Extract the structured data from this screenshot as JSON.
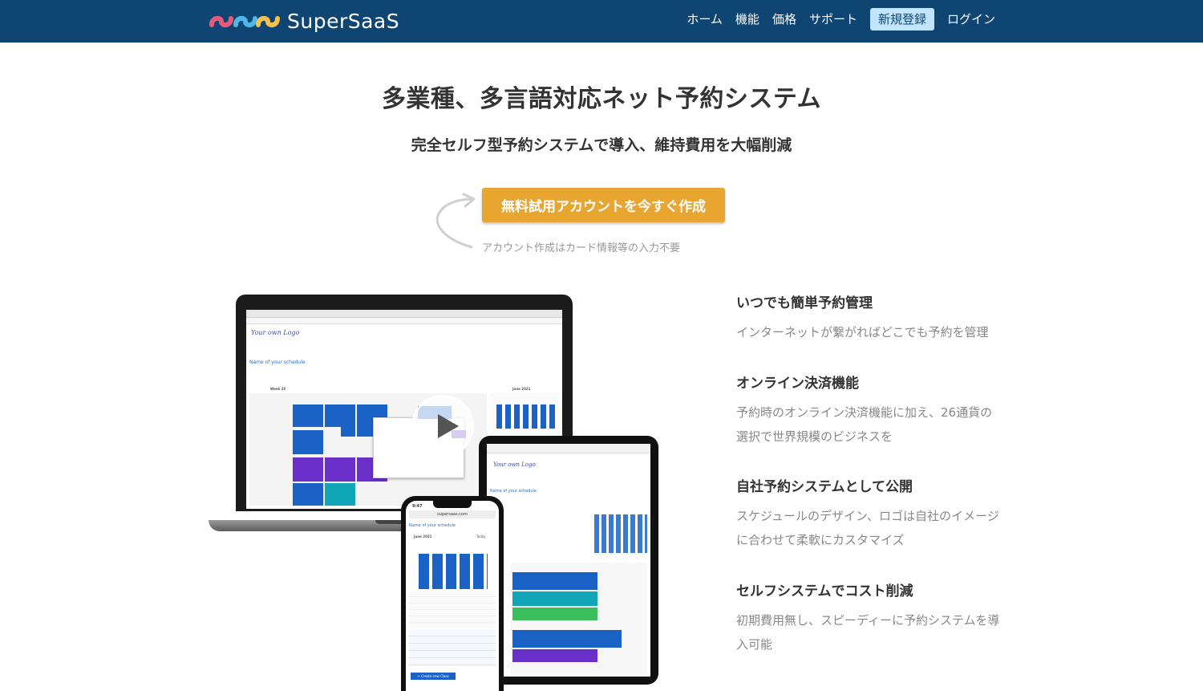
{
  "brand": {
    "name": "SuperSaaS"
  },
  "nav": {
    "home": "ホーム",
    "features": "機能",
    "pricing": "価格",
    "support": "サポート",
    "signup": "新規登録",
    "login": "ログイン"
  },
  "hero": {
    "title": "多業種、多言語対応ネット予約システム",
    "subtitle": "完全セルフ型予約システムで導入、維持費用を大幅削減",
    "cta": "無料試用アカウントを今すぐ作成",
    "cta_note": "アカウント作成はカード情報等の入力不要"
  },
  "features": [
    {
      "title": "いつでも簡単予約管理",
      "desc": "インターネットが繋がればどこでも予約を管理"
    },
    {
      "title": "オンライン決済機能",
      "desc": "予約時のオンライン決済機能に加え、26通貨の選択で世界規模のビジネスを"
    },
    {
      "title": "自社予約システムとして公開",
      "desc": "スケジュールのデザイン、ロゴは自社のイメージに合わせて柔軟にカスタマイズ"
    },
    {
      "title": "セルフシステムでコスト削減",
      "desc": "初期費用無し、スピーディーに予約システムを導入可能"
    }
  ],
  "screens": {
    "laptop_schedule_title": "Name of your schedule",
    "tablet_schedule_title": "Name of your schedule",
    "phone_schedule_title": "Name of your schedule",
    "phone_url": "supersaas.com",
    "phone_month": "June 2021",
    "phone_today": "Today",
    "phone_time": "9:47",
    "laptop_logo": "Your own Logo",
    "laptop_week": "Week 25",
    "laptop_month_label": "June 2021",
    "phone_create_button": "+ Create new Class"
  },
  "colors": {
    "navbar": "#0f4573",
    "cta": "#e8a530",
    "signup_bg": "#bfe4fb"
  },
  "icons": {
    "play": "play-icon",
    "arrow": "curved-arrow-icon"
  }
}
